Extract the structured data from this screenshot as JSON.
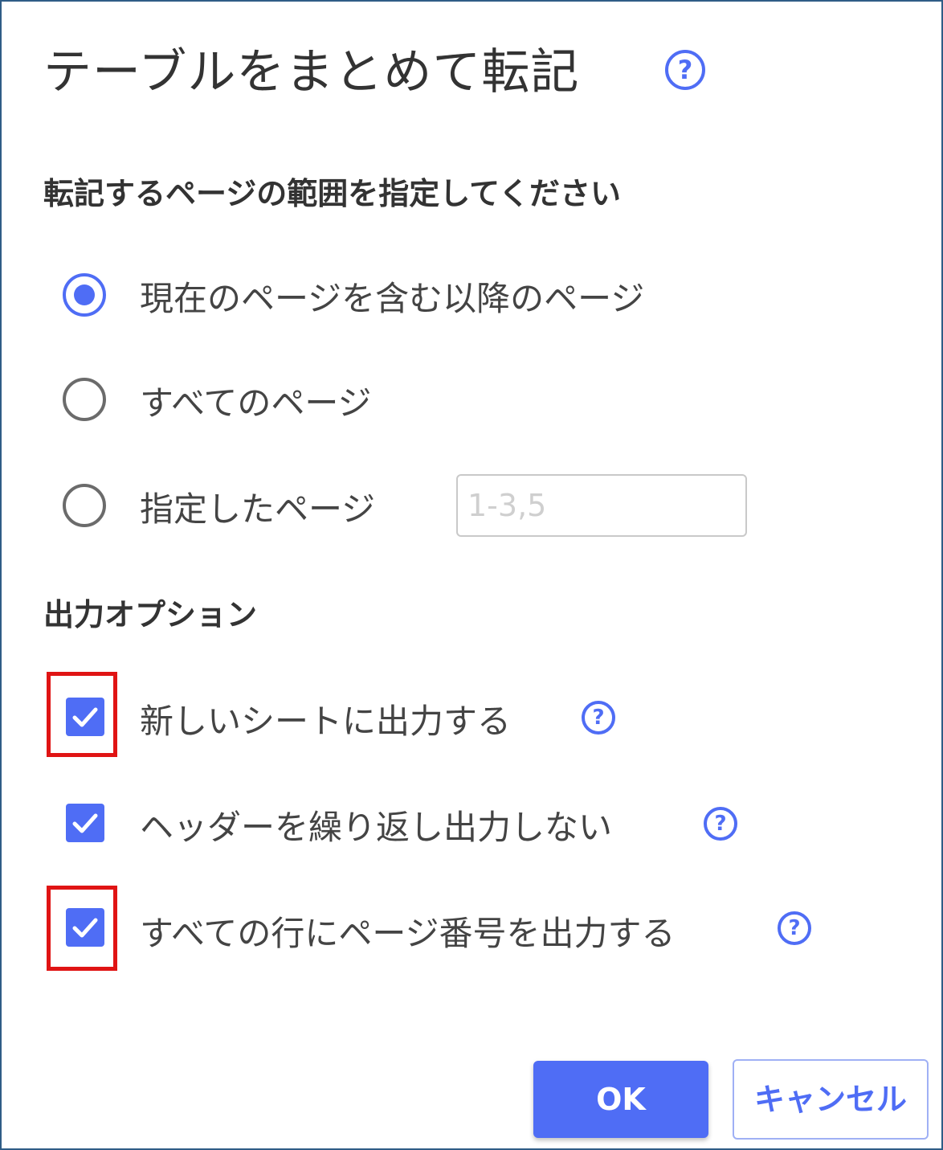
{
  "dialog": {
    "title": "テーブルをまとめて転記",
    "title_help_glyph": "?"
  },
  "page_range": {
    "heading": "転記するページの範囲を指定してください",
    "options": [
      {
        "label": "現在のページを含む以降のページ",
        "selected": true
      },
      {
        "label": "すべてのページ",
        "selected": false
      },
      {
        "label": "指定したページ",
        "selected": false
      }
    ],
    "pages_input": {
      "value": "",
      "placeholder": "1-3,5"
    }
  },
  "output_options": {
    "heading": "出力オプション",
    "items": [
      {
        "label": "新しいシートに出力する",
        "checked": true,
        "help_glyph": "?",
        "highlighted": true
      },
      {
        "label": "ヘッダーを繰り返し出力しない",
        "checked": true,
        "help_glyph": "?",
        "highlighted": false
      },
      {
        "label": "すべての行にページ番号を出力する",
        "checked": true,
        "help_glyph": "?",
        "highlighted": true
      }
    ]
  },
  "buttons": {
    "ok_label": "OK",
    "cancel_label": "キャンセル"
  },
  "colors": {
    "accent": "#4f6df5",
    "highlight": "#e01414",
    "border": "#2f5c86"
  },
  "icons": {
    "help": "question-circle-icon",
    "check": "checkmark-icon"
  }
}
